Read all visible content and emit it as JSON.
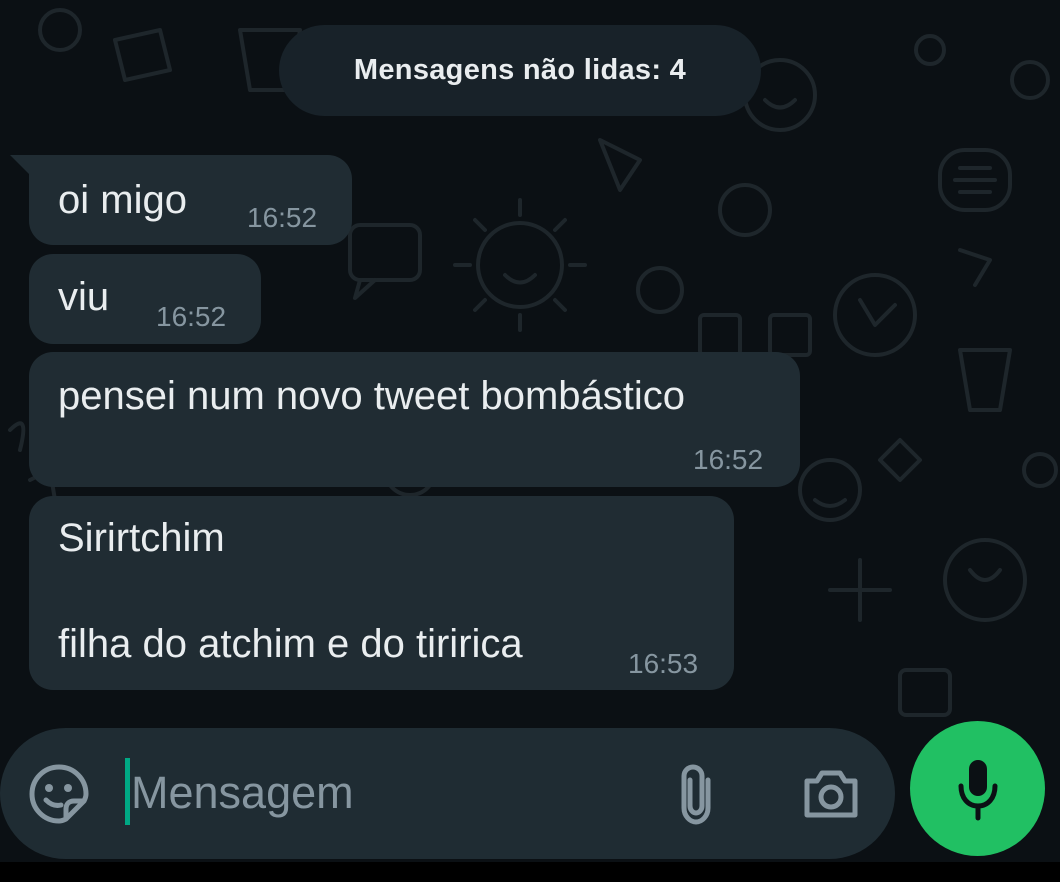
{
  "chat": {
    "unread_banner": "Mensagens não lidas: 4",
    "messages": [
      {
        "lines": "oi migo",
        "time": "16:52"
      },
      {
        "lines": "viu",
        "time": "16:52"
      },
      {
        "lines": "pensei num novo tweet bombástico",
        "time": "16:52"
      },
      {
        "line1": "Sirirtchim",
        "line2": "filha do atchim e do tiririca",
        "time": "16:53"
      }
    ]
  },
  "composer": {
    "placeholder": "Mensagem",
    "value": ""
  },
  "icons": {
    "emoji": "sticker-emoji-icon",
    "attach": "paperclip-icon",
    "camera": "camera-icon",
    "mic": "microphone-icon"
  },
  "colors": {
    "background": "#0b1014",
    "bubble": "#202c33",
    "input_bar": "#1f2c33",
    "mic_button": "#21c063",
    "caret": "#00a884",
    "timestamp": "#8696a0"
  }
}
